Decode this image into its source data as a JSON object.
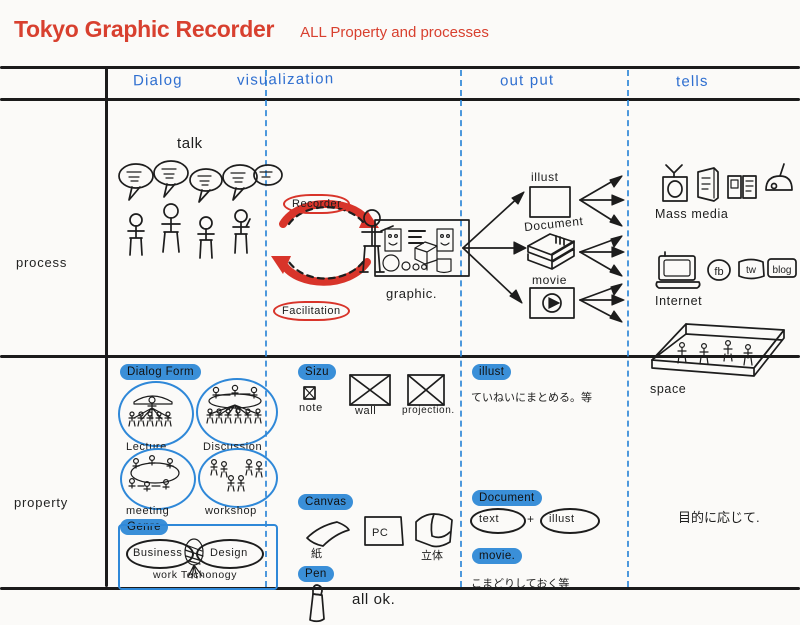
{
  "title": "Tokyo Graphic Recorder",
  "subtitle": "ALL Property and processes",
  "accent_color": "#D8402F",
  "header_color": "#2f6fd0",
  "columns": [
    {
      "id": "dialog",
      "label": "Dialog"
    },
    {
      "id": "visualization",
      "label": "visualization"
    },
    {
      "id": "output",
      "label": "out put"
    },
    {
      "id": "tells",
      "label": "tells"
    }
  ],
  "rows": [
    {
      "id": "process",
      "label": "process"
    },
    {
      "id": "property",
      "label": "property"
    }
  ],
  "process": {
    "dialog": {
      "talk_label": "talk"
    },
    "visualization": {
      "recorder_label": "Recorder",
      "facilitation_label": "Facilitation",
      "graphic_label": "graphic."
    },
    "output": {
      "items": [
        {
          "label": "illust",
          "icon": "illustration-frame-icon"
        },
        {
          "label": "Document",
          "icon": "stacked-papers-icon"
        },
        {
          "label": "movie",
          "icon": "video-play-icon"
        }
      ]
    },
    "tells": {
      "mass_media_label": "Mass media",
      "mass_media_icons": [
        "tv-icon",
        "newspaper-icon",
        "magazine-icon",
        "radio-icon"
      ],
      "internet_label": "Internet",
      "internet_icons": [
        "computer-icon",
        "fb-icon",
        "tw-icon",
        "blog-icon"
      ],
      "internet_tags": [
        "fb",
        "tw",
        "blog"
      ],
      "space_label": "space",
      "space_icon": "room-box-icon"
    }
  },
  "property": {
    "dialog": {
      "section_dialog_form": "Dialog Form",
      "forms": [
        {
          "label": "Lecture",
          "icon": "lecture-people-icon"
        },
        {
          "label": "Discussion",
          "icon": "discussion-people-icon"
        },
        {
          "label": "meeting",
          "icon": "meeting-people-icon"
        },
        {
          "label": "workshop",
          "icon": "workshop-people-icon"
        }
      ],
      "section_genre": "Genre",
      "genres": [
        "Business",
        "Design"
      ],
      "genre_note": "work Techonogy"
    },
    "visualization": {
      "section_size": "Sizu",
      "sizes": [
        {
          "label": "note",
          "icon": "note-square-icon"
        },
        {
          "label": "wall",
          "icon": "wall-square-icon"
        },
        {
          "label": "projection.",
          "icon": "projection-square-icon"
        }
      ],
      "section_canvas": "Canvas",
      "canvases": [
        {
          "label": "紙",
          "icon": "paper-sheet-icon"
        },
        {
          "label": "PC",
          "icon": "pc-screen-icon"
        },
        {
          "label": "立体",
          "icon": "solid-cube-icon"
        }
      ],
      "section_pen": "Pen",
      "pen_note": "all ok.",
      "pen_icon": "marker-pen-icon"
    },
    "output": {
      "section_illust": "illust",
      "illust_note": "ていねいにまとめる。等",
      "section_document": "Document",
      "document_parts": [
        "text",
        "illust"
      ],
      "document_joiner": "+",
      "section_movie": "movie.",
      "movie_note": "こまどりしておく等"
    },
    "tells": {
      "note": "目的に応じて."
    }
  }
}
